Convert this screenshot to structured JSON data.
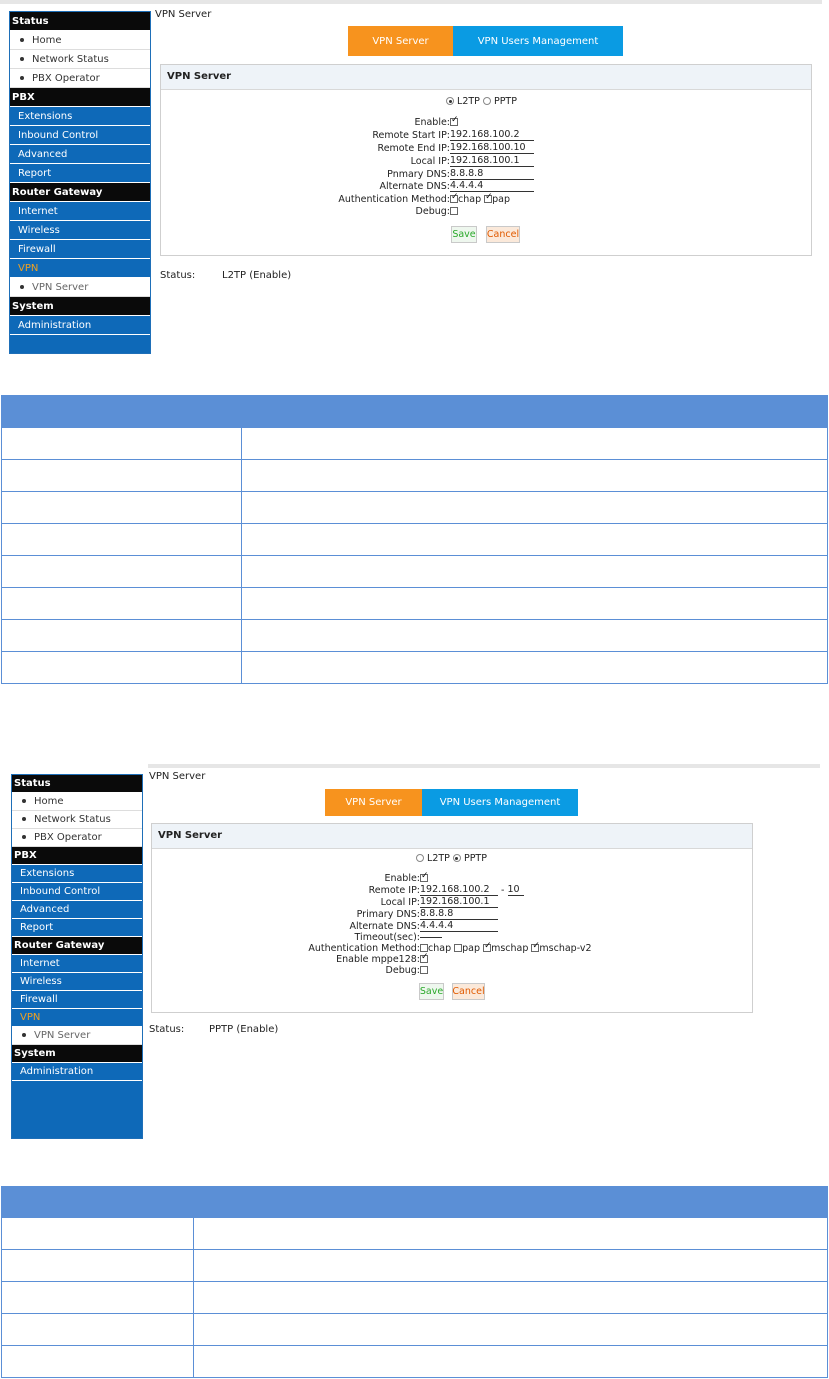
{
  "sidebar": {
    "status": "Status",
    "home": "Home",
    "network_status": "Network Status",
    "pbx_operator": "PBX Operator",
    "pbx": "PBX",
    "extensions": "Extensions",
    "inbound_control": "Inbound Control",
    "advanced": "Advanced",
    "report": "Report",
    "router_gateway": "Router Gateway",
    "internet": "Internet",
    "wireless": "Wireless",
    "firewall": "Firewall",
    "vpn": "VPN",
    "vpn_server": "VPN Server",
    "system": "System",
    "administration": "Administration"
  },
  "breadcrumb": "VPN Server",
  "tabs": {
    "vpn_server": "VPN Server",
    "vpn_users": "VPN Users Management"
  },
  "panel_title": "VPN Server",
  "shot1": {
    "protocol_l2tp": "L2TP",
    "protocol_pptp": "PPTP",
    "selected_protocol": "L2TP",
    "enable_label": "Enable:",
    "enable_checked": true,
    "remote_start_ip_label": "Remote Start IP:",
    "remote_start_ip": "192.168.100.2",
    "remote_end_ip_label": "Remote End IP:",
    "remote_end_ip": "192.168.100.10",
    "local_ip_label": "Local IP:",
    "local_ip": "192.168.100.1",
    "primary_dns_label": "Pnmary DNS:",
    "primary_dns": "8.8.8.8",
    "alternate_dns_label": "Alternate DNS:",
    "alternate_dns": "4.4.4.4",
    "auth_method_label": "Authentication Method:",
    "auth_chap": "chap",
    "auth_pap": "pap",
    "debug_label": "Debug:",
    "save": "Save",
    "cancel": "Cancel",
    "status_label": "Status:",
    "status_value": "L2TP (Enable)"
  },
  "shot2": {
    "protocol_l2tp": "L2TP",
    "protocol_pptp": "PPTP",
    "selected_protocol": "PPTP",
    "enable_label": "Enable:",
    "remote_ip_label": "Remote IP:",
    "remote_ip": "192.168.100.2",
    "remote_ip_sep": "-",
    "remote_ip_end": "10",
    "local_ip_label": "Local IP:",
    "local_ip": "192.168.100.1",
    "primary_dns_label": "Primary DNS:",
    "primary_dns": "8.8.8.8",
    "alternate_dns_label": "Alternate DNS:",
    "alternate_dns": "4.4.4.4",
    "timeout_label": "Timeout(sec):",
    "timeout": "",
    "auth_method_label": "Authentication Method:",
    "auth_chap": "chap",
    "auth_pap": "pap",
    "auth_mschap": "mschap",
    "auth_mschapv2": "mschap-v2",
    "mppe_label": "Enable mppe128:",
    "debug_label": "Debug:",
    "save": "Save",
    "cancel": "Cancel",
    "status_label": "Status:",
    "status_value": "PPTP (Enable)"
  },
  "table1": {
    "rows": 8
  },
  "table2": {
    "rows": 5
  }
}
